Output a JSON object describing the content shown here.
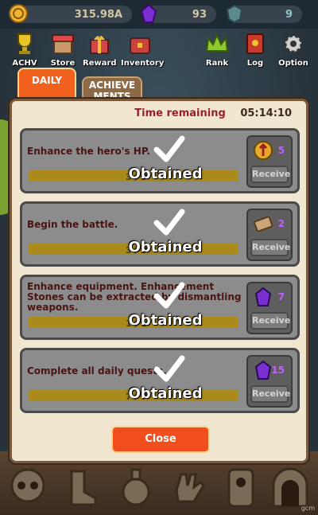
{
  "currency": {
    "gold": "315.98A",
    "gems": "93",
    "tokens": "9"
  },
  "menu": [
    {
      "label": "ACHV",
      "icon": "trophy-icon"
    },
    {
      "label": "Store",
      "icon": "store-icon"
    },
    {
      "label": "Reward",
      "icon": "gift-icon"
    },
    {
      "label": "Inventory",
      "icon": "chest-icon"
    },
    {
      "label": "Rank",
      "icon": "crown-icon"
    },
    {
      "label": "Log",
      "icon": "book-icon"
    },
    {
      "label": "Option",
      "icon": "gear-icon"
    }
  ],
  "tabs": {
    "daily": "DAILY",
    "achievements": "ACHIEVE\nMENTS"
  },
  "timer": {
    "label": "Time remaining",
    "value": "05:14:10"
  },
  "quests": [
    {
      "text": "Enhance the hero's HP.",
      "reward": "5",
      "reward_icon": "gold-coin-icon",
      "count": "3 / 3",
      "status": "Obtained",
      "button": "Receive"
    },
    {
      "text": "Begin the battle.",
      "reward": "2",
      "reward_icon": "ticket-icon",
      "count": "3 / 3",
      "status": "Obtained",
      "button": "Receive"
    },
    {
      "text": "Enhance equipment. Enhancement Stones can be extracted by dismantling weapons.",
      "reward": "7",
      "reward_icon": "gem-icon",
      "count": "1 / 1",
      "status": "Obtained",
      "button": "Receive"
    },
    {
      "text": "Complete all daily quests.",
      "reward": "15",
      "reward_icon": "gem-icon",
      "count": "7 / 7",
      "status": "Obtained",
      "button": "Receive"
    }
  ],
  "close_label": "Close",
  "watermark": "gcm"
}
